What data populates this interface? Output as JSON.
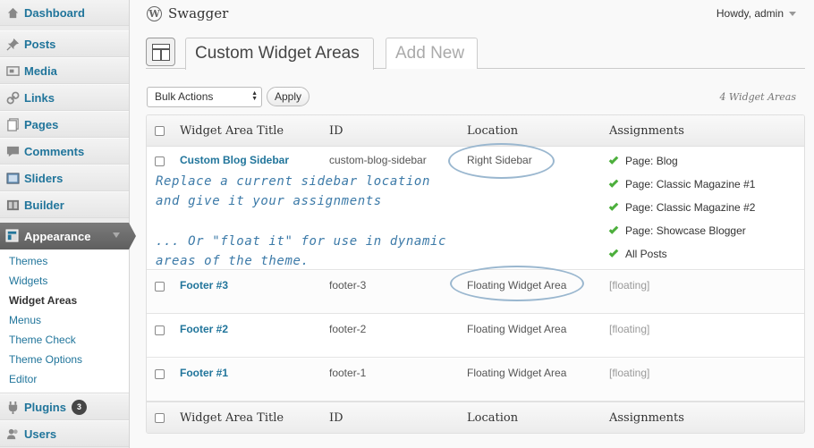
{
  "sidebar": {
    "dashboard": "Dashboard",
    "posts": "Posts",
    "media": "Media",
    "links": "Links",
    "pages": "Pages",
    "comments": "Comments",
    "sliders": "Sliders",
    "builder": "Builder",
    "appearance": "Appearance",
    "submenu": [
      "Themes",
      "Widgets",
      "Widget Areas",
      "Menus",
      "Theme Check",
      "Theme Options",
      "Editor"
    ],
    "plugins": "Plugins",
    "plugins_count": "3",
    "users": "Users"
  },
  "header": {
    "site_title": "Swagger",
    "greeting": "Howdy, admin"
  },
  "tabs": {
    "active": "Custom Widget Areas",
    "add_new": "Add New"
  },
  "toolbar": {
    "bulk_actions": "Bulk Actions",
    "apply": "Apply",
    "count": "4 Widget Areas"
  },
  "table": {
    "columns": [
      "Widget Area Title",
      "ID",
      "Location",
      "Assignments"
    ],
    "rows": [
      {
        "title": "Custom Blog Sidebar",
        "id": "custom-blog-sidebar",
        "location": "Right Sidebar",
        "assignments": [
          "Page: Blog",
          "Page: Classic Magazine #1",
          "Page: Classic Magazine #2",
          "Page: Showcase Blogger",
          "All Posts"
        ]
      },
      {
        "title": "Footer #3",
        "id": "footer-3",
        "location": "Floating Widget Area",
        "assignments": "[floating]"
      },
      {
        "title": "Footer #2",
        "id": "footer-2",
        "location": "Floating Widget Area",
        "assignments": "[floating]"
      },
      {
        "title": "Footer #1",
        "id": "footer-1",
        "location": "Floating Widget Area",
        "assignments": "[floating]"
      }
    ]
  },
  "annotations": {
    "line1": "Replace a current sidebar location",
    "line2": "and give it your assignments",
    "line3": "... Or \"float it\" for use in dynamic",
    "line4": "areas of the theme."
  },
  "colors": {
    "link": "#21759b",
    "annotation": "#3c7aa8",
    "check": "#4caf3c",
    "menu_active": "#5f5f5f"
  }
}
